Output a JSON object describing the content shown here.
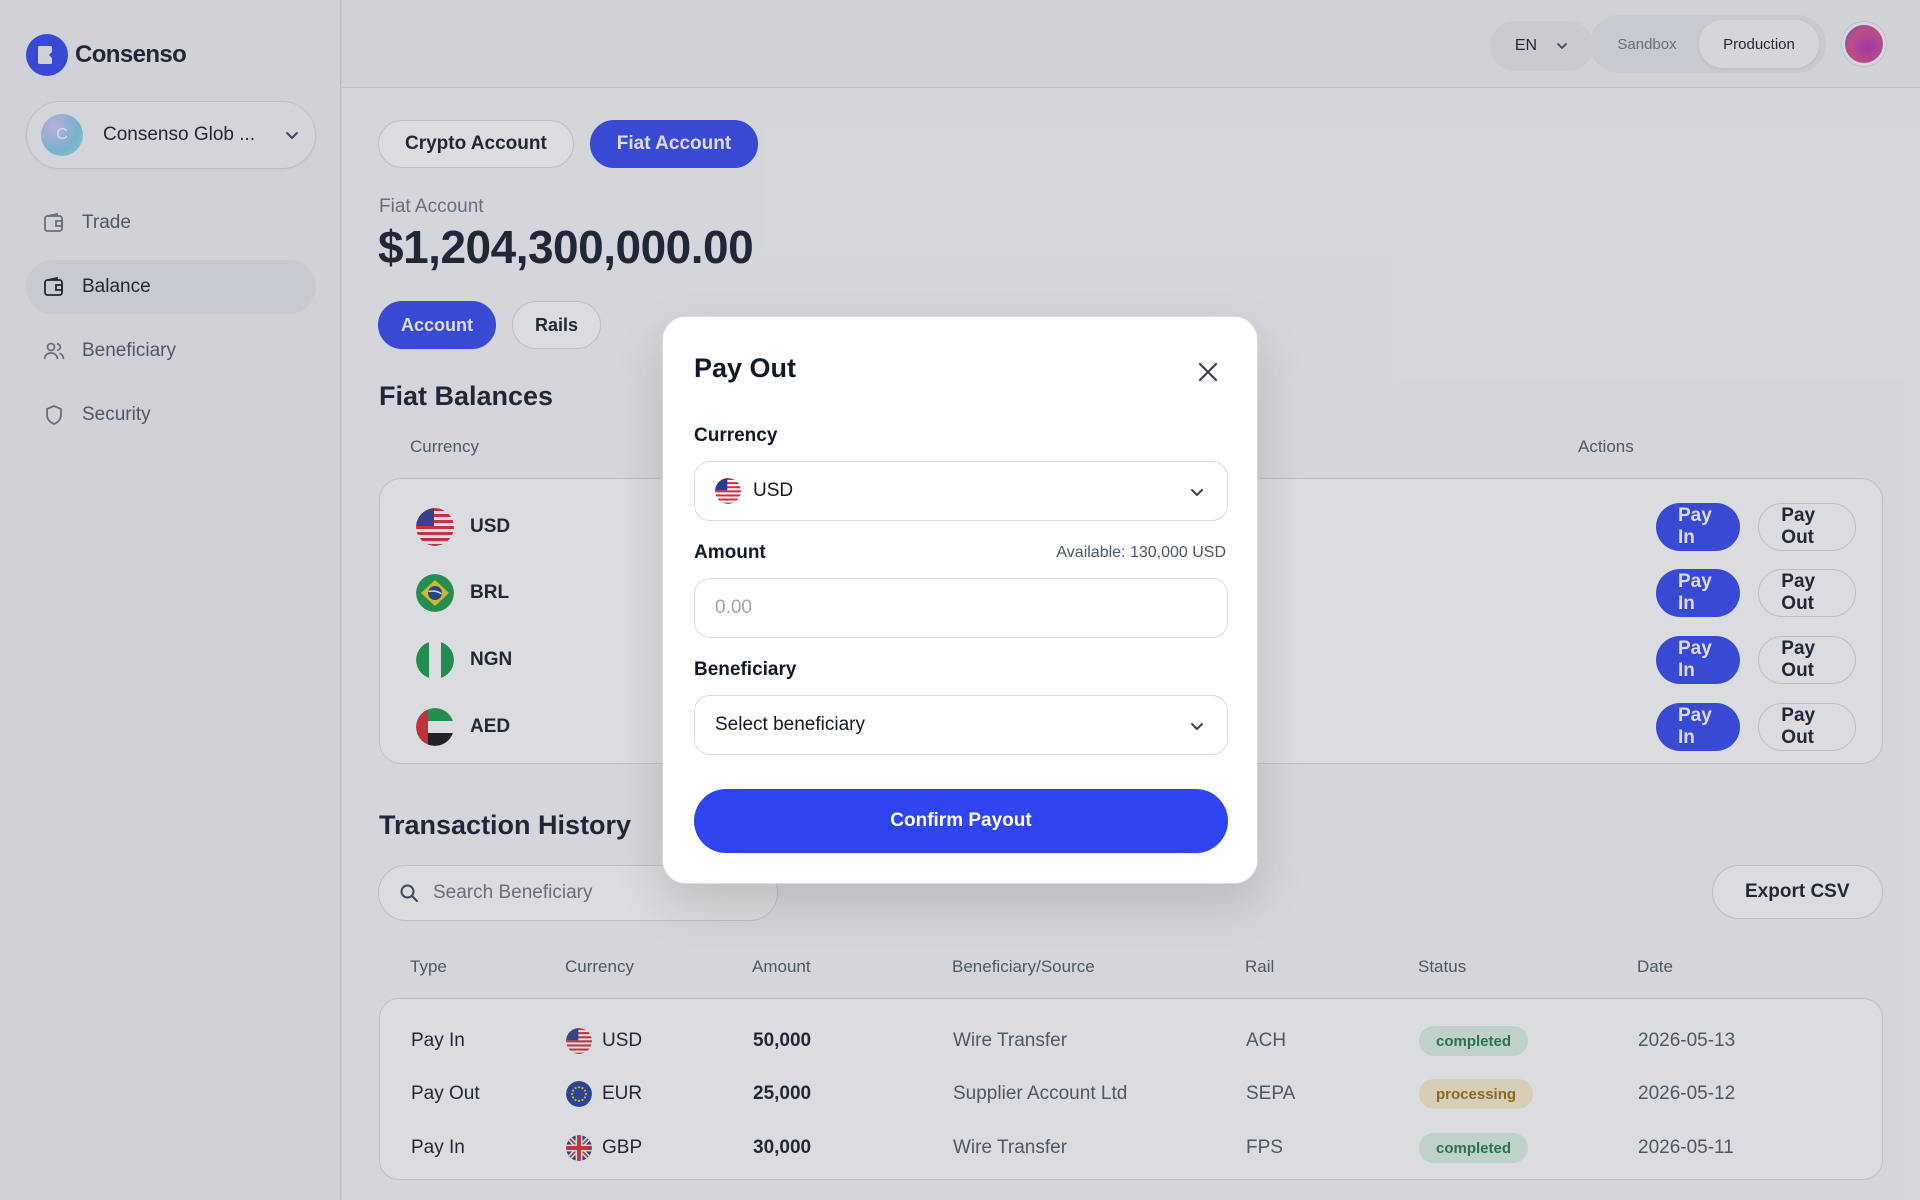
{
  "brand": {
    "name": "Consenso",
    "accent": "#2f45f1"
  },
  "org": {
    "initial": "C",
    "name": "Consenso Glob ..."
  },
  "nav": [
    {
      "label": "Trade",
      "icon": "wallet-icon",
      "active": false
    },
    {
      "label": "Balance",
      "icon": "wallet-icon",
      "active": true
    },
    {
      "label": "Beneficiary",
      "icon": "users-icon",
      "active": false
    },
    {
      "label": "Security",
      "icon": "shield-icon",
      "active": false
    }
  ],
  "topbar": {
    "language": "EN",
    "env_options": [
      "Sandbox",
      "Production"
    ],
    "env_selected": "Production"
  },
  "account_tabs": [
    "Crypto Account",
    "Fiat Account"
  ],
  "account_tab_selected": "Fiat Account",
  "fiat": {
    "label": "Fiat Account",
    "amount": "$1,204,300,000.00"
  },
  "sub_tabs": [
    "Account",
    "Rails"
  ],
  "sub_tab_selected": "Account",
  "balances": {
    "title": "Fiat Balances",
    "headers": {
      "currency": "Currency",
      "actions": "Actions"
    },
    "rows": [
      {
        "code": "USD",
        "flag": "us-flag-icon"
      },
      {
        "code": "BRL",
        "flag": "br-flag-icon"
      },
      {
        "code": "NGN",
        "flag": "ng-flag-icon"
      },
      {
        "code": "AED",
        "flag": "ae-flag-icon"
      }
    ],
    "pay_in_label": "Pay In",
    "pay_out_label": "Pay Out"
  },
  "transactions": {
    "title": "Transaction History",
    "search_placeholder": "Search Beneficiary",
    "export_label": "Export CSV",
    "headers": [
      "Type",
      "Currency",
      "Amount",
      "Beneficiary/Source",
      "Rail",
      "Status",
      "Date"
    ],
    "rows": [
      {
        "type": "Pay In",
        "currency": "USD",
        "flag": "us-flag-icon",
        "amount": "50,000",
        "beneficiary": "Wire Transfer",
        "rail": "ACH",
        "status": "completed",
        "date": "2026-05-13"
      },
      {
        "type": "Pay Out",
        "currency": "EUR",
        "flag": "eu-flag-icon",
        "amount": "25,000",
        "beneficiary": "Supplier Account Ltd",
        "rail": "SEPA",
        "status": "processing",
        "date": "2026-05-12"
      },
      {
        "type": "Pay In",
        "currency": "GBP",
        "flag": "gb-flag-icon",
        "amount": "30,000",
        "beneficiary": "Wire Transfer",
        "rail": "FPS",
        "status": "completed",
        "date": "2026-05-11"
      }
    ]
  },
  "modal": {
    "title": "Pay Out",
    "currency_label": "Currency",
    "currency_value": "USD",
    "amount_label": "Amount",
    "available": "Available: 130,000 USD",
    "amount_placeholder": "0.00",
    "beneficiary_label": "Beneficiary",
    "beneficiary_value": "Select beneficiary",
    "confirm_label": "Confirm Payout"
  }
}
